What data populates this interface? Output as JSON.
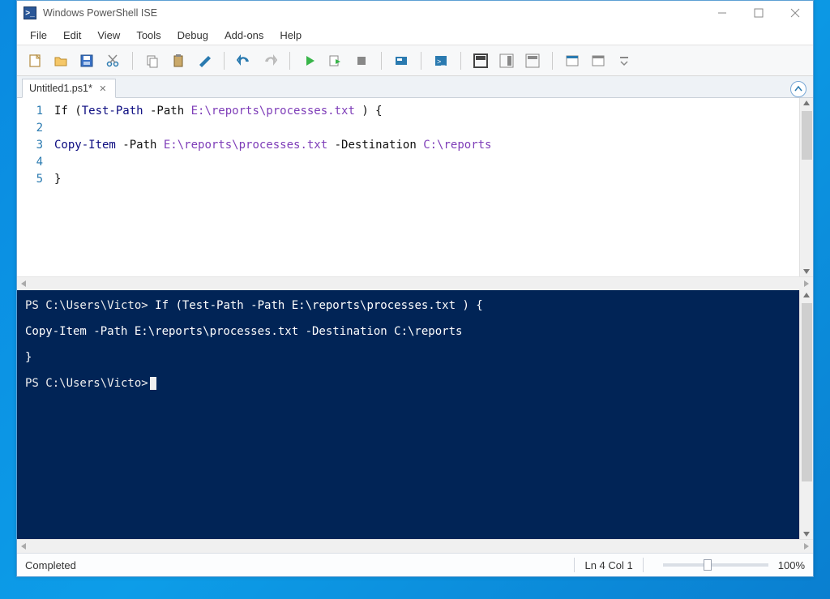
{
  "window": {
    "title": "Windows PowerShell ISE"
  },
  "menu": {
    "file": "File",
    "edit": "Edit",
    "view": "View",
    "tools": "Tools",
    "debug": "Debug",
    "addons": "Add-ons",
    "help": "Help"
  },
  "tab": {
    "name": "Untitled1.ps1*"
  },
  "editor": {
    "lines": [
      "1",
      "2",
      "3",
      "4",
      "5"
    ],
    "l1_if": "If",
    "l1_open": " (",
    "l1_cmd": "Test-Path",
    "l1_p": " -Path ",
    "l1_arg": "E:\\reports\\processes.txt",
    "l1_tail": " ) {",
    "l3_cmd": "Copy-Item",
    "l3_p1": " -Path ",
    "l3_arg1": "E:\\reports\\processes.txt",
    "l3_p2": " -Destination ",
    "l3_arg2": "C:\\reports",
    "l5": "}"
  },
  "console": {
    "line1a": "PS C:\\Users\\Victo> ",
    "line1b": "If (Test-Path -Path E:\\reports\\processes.txt ) {",
    "line2": "Copy-Item -Path E:\\reports\\processes.txt -Destination C:\\reports",
    "line3": "}",
    "line4a": "PS C:\\Users\\Victo>"
  },
  "status": {
    "left": "Completed",
    "pos": "Ln 4  Col 1",
    "zoom": "100%"
  }
}
